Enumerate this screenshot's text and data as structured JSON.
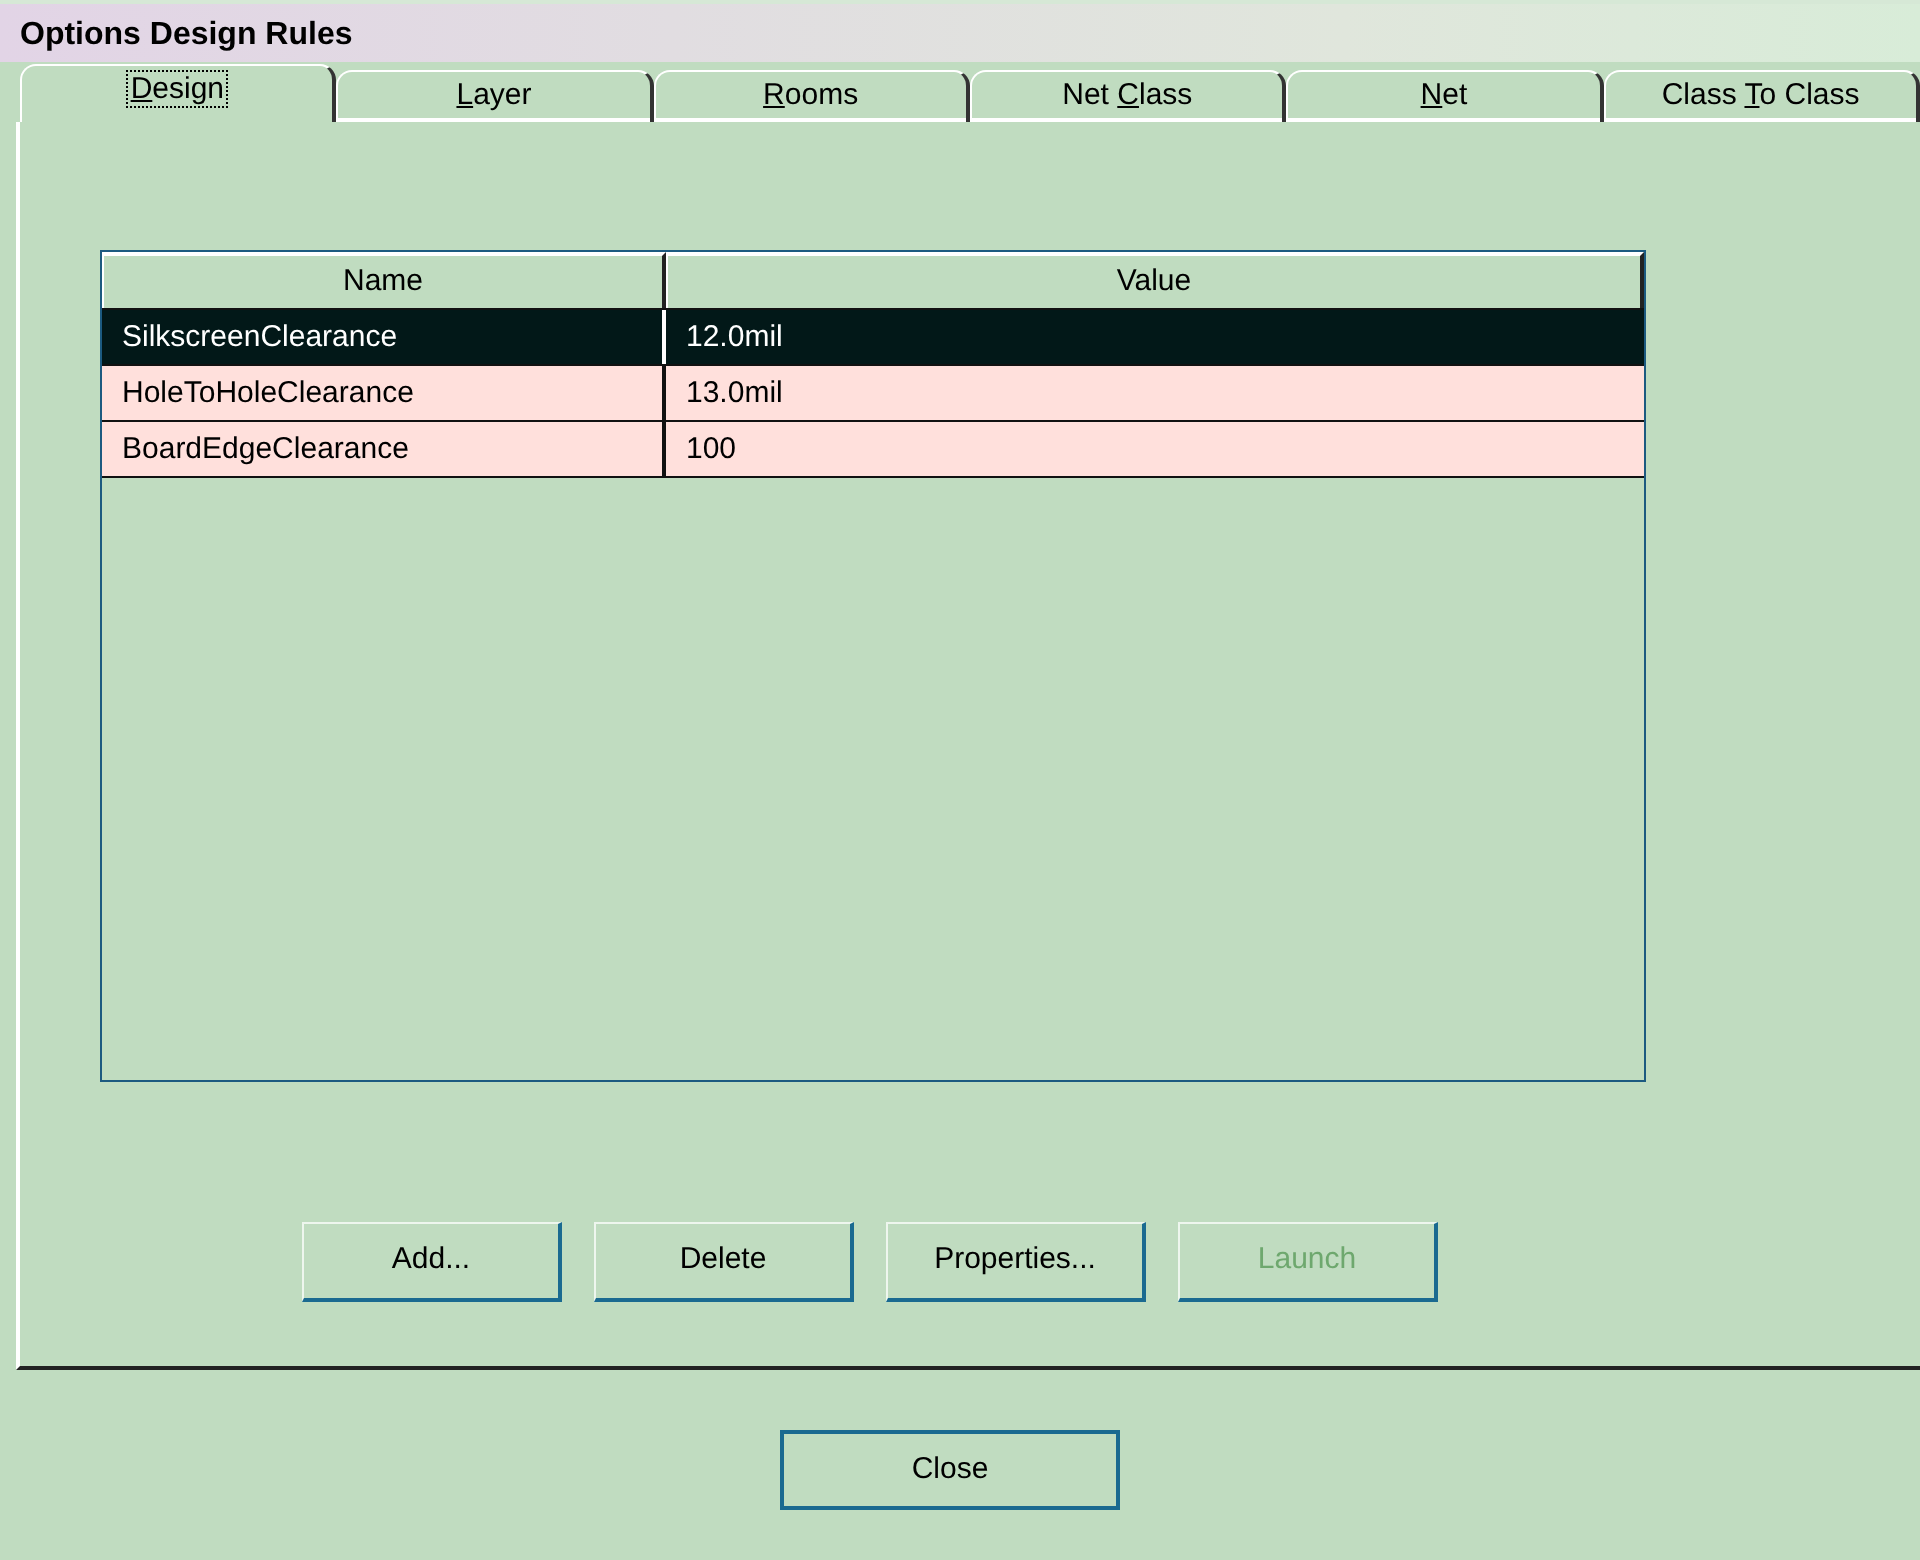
{
  "window": {
    "title": "Options Design Rules"
  },
  "tabs": [
    {
      "key": "D",
      "post": "esign",
      "selected": true,
      "focused": true
    },
    {
      "key": "L",
      "post": "ayer",
      "selected": false,
      "focused": false
    },
    {
      "key": "R",
      "post": "ooms",
      "selected": false,
      "focused": false
    },
    {
      "pre": "Net ",
      "key": "C",
      "post": "lass",
      "selected": false,
      "focused": false
    },
    {
      "key": "N",
      "post": "et",
      "selected": false,
      "focused": false
    },
    {
      "pre": "Class ",
      "key": "T",
      "post": "o Class",
      "selected": false,
      "focused": false
    }
  ],
  "table": {
    "columns": [
      "Name",
      "Value"
    ],
    "rows": [
      {
        "cells": [
          "SilkscreenClearance",
          "12.0mil"
        ],
        "selected": true
      },
      {
        "cells": [
          "HoleToHoleClearance",
          "13.0mil"
        ],
        "selected": false
      },
      {
        "cells": [
          "BoardEdgeClearance",
          "100"
        ],
        "selected": false
      }
    ]
  },
  "buttons": [
    {
      "label": "Add...",
      "disabled": false
    },
    {
      "label": "Delete",
      "disabled": false
    },
    {
      "label": "Properties...",
      "disabled": false
    },
    {
      "label": "Launch",
      "disabled": true
    }
  ],
  "footer_buttons": [
    {
      "label": "Close",
      "default": true
    }
  ]
}
